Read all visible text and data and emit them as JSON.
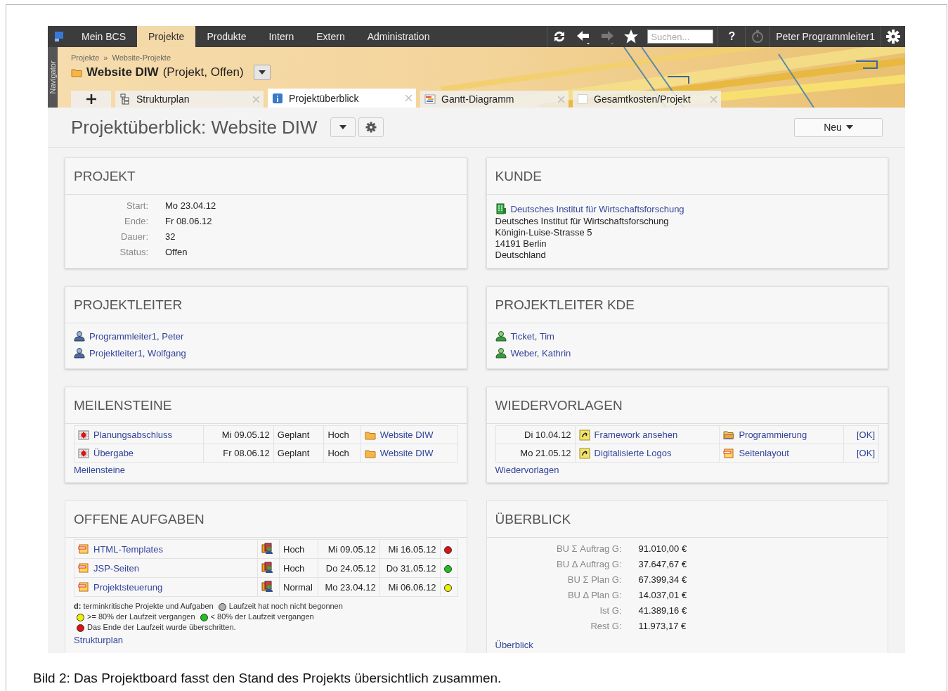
{
  "menu": [
    {
      "label": "Mein BCS",
      "selected": false
    },
    {
      "label": "Projekte",
      "selected": true
    },
    {
      "label": "Produkte",
      "selected": false
    },
    {
      "label": "Intern",
      "selected": false
    },
    {
      "label": "Extern",
      "selected": false
    },
    {
      "label": "Administration",
      "selected": false
    }
  ],
  "toolbar": [
    {
      "kind": "refresh",
      "disabled": false
    },
    {
      "kind": "back",
      "disabled": false
    },
    {
      "kind": "forward",
      "disabled": true
    },
    {
      "kind": "star",
      "disabled": false
    },
    {
      "kind": "search",
      "placeholder": "Suchen..."
    },
    {
      "kind": "help",
      "label": "?"
    },
    {
      "kind": "timer",
      "disabled": true
    },
    {
      "kind": "user",
      "label": "Peter Programmleiter1"
    },
    {
      "kind": "settings",
      "disabled": false
    }
  ],
  "navigator": "Navigator",
  "breadcrumb": {
    "items": [
      "Projekte",
      "Website-Projekte"
    ],
    "separator": "»"
  },
  "project": {
    "name": "Website DIW",
    "meta": "(Projekt, Offen)"
  },
  "tabs": [
    {
      "label": "Strukturplan",
      "kind": "structure",
      "selected": false
    },
    {
      "label": "Projektüberblick",
      "kind": "info",
      "selected": true
    },
    {
      "label": "Gantt-Diagramm",
      "kind": "gantt",
      "selected": false
    },
    {
      "label": "Gesamtkosten/Projekt",
      "kind": "cost",
      "selected": false
    }
  ],
  "page_title": "Projektüberblick: Website DIW",
  "new_button": "Neu",
  "projekt": {
    "title": "PROJEKT",
    "fields": [
      {
        "label": "Start:",
        "value": "Mo 23.04.12"
      },
      {
        "label": "Ende:",
        "value": "Fr 08.06.12"
      },
      {
        "label": "Dauer:",
        "value": "32"
      },
      {
        "label": "Status:",
        "value": "Offen"
      }
    ]
  },
  "kunde": {
    "title": "KUNDE",
    "link": "Deutsches Institut für Wirtschaftsforschung",
    "address": [
      "Deutsches Institut für Wirtschaftsforschung",
      "Königin-Luise-Strasse 5",
      "14191 Berlin",
      "Deutschland"
    ]
  },
  "projektleiter": {
    "title": "PROJEKTLEITER",
    "people": [
      "Programmleiter1, Peter",
      "Projektleiter1, Wolfgang"
    ]
  },
  "projektleiter_kde": {
    "title": "PROJEKTLEITER KDE",
    "people": [
      "Ticket, Tim",
      "Weber, Kathrin"
    ]
  },
  "meilensteine": {
    "title": "MEILENSTEINE",
    "rows": [
      {
        "name": "Planungsabschluss",
        "date": "Mi 09.05.12",
        "status": "Geplant",
        "priority": "Hoch",
        "project": "Website DIW"
      },
      {
        "name": "Übergabe",
        "date": "Fr 08.06.12",
        "status": "Geplant",
        "priority": "Hoch",
        "project": "Website DIW"
      }
    ],
    "footer_link": "Meilensteine"
  },
  "wiedervorlagen": {
    "title": "WIEDERVORLAGEN",
    "rows": [
      {
        "date": "Di 10.04.12",
        "task": "Framework ansehen",
        "target": "Programmierung",
        "kind": "folder",
        "action": "[OK]"
      },
      {
        "date": "Mo 21.05.12",
        "task": "Digitalisierte Logos",
        "target": "Seitenlayout",
        "kind": "task",
        "action": "[OK]"
      }
    ],
    "footer_link": "Wiedervorlagen"
  },
  "offene_aufgaben": {
    "title": "OFFENE AUFGABEN",
    "rows": [
      {
        "name": "HTML-Templates",
        "priority": "Hoch",
        "start": "Mi 09.05.12",
        "end": "Mi 16.05.12",
        "color": "#e01010"
      },
      {
        "name": "JSP-Seiten",
        "priority": "Hoch",
        "start": "Do 24.05.12",
        "end": "Do 31.05.12",
        "color": "#20c020"
      },
      {
        "name": "Projektsteuerung",
        "priority": "Normal",
        "start": "Mo 23.04.12",
        "end": "Mi 06.06.12",
        "color": "#f0f000"
      }
    ],
    "legend": {
      "intro": "**d:** terminkritische Projekte und Aufgaben",
      "items": [
        {
          "text": "Laufzeit hat noch nicht begonnen",
          "color": "#b0b0b0"
        },
        {
          "text": ">= 80% der Laufzeit vergangen",
          "color": "#f0f000"
        },
        {
          "text": "< 80% der Laufzeit vergangen",
          "color": "#20c020"
        },
        {
          "text": "Das Ende der Laufzeit wurde überschritten.",
          "color": "#e01010"
        }
      ]
    },
    "footer_link": "Strukturplan"
  },
  "ueberblick": {
    "title": "ÜBERBLICK",
    "fields": [
      {
        "label": "BU Σ Auftrag G:",
        "value": "91.010,00 €"
      },
      {
        "label": "BU Δ Auftrag G:",
        "value": "37.647,67 €"
      },
      {
        "label": "BU Σ Plan G:",
        "value": "67.399,34 €"
      },
      {
        "label": "BU Δ Plan G:",
        "value": "14.037,01 €"
      },
      {
        "label": "Ist G:",
        "value": "41.389,16 €"
      },
      {
        "label": "Rest G:",
        "value": "11.973,17 €"
      }
    ],
    "footer_link": "Überblick"
  },
  "caption": "Bild 2: Das Projektboard fasst den Stand des Projekts übersichtlich zusammen."
}
